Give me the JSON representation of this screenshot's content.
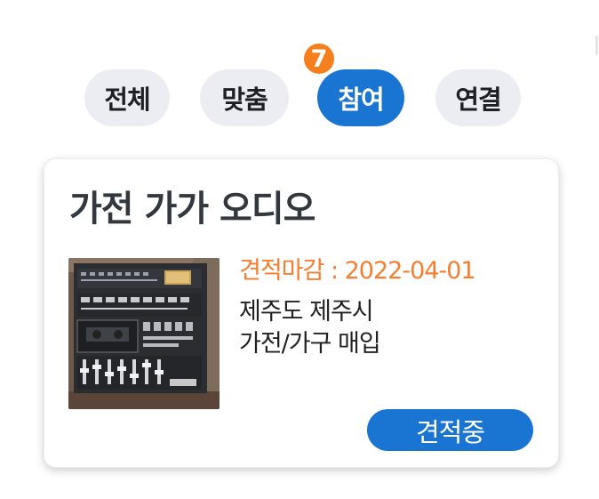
{
  "tabs": [
    {
      "label": "전체",
      "active": false
    },
    {
      "label": "맞춤",
      "active": false
    },
    {
      "label": "참여",
      "active": true
    },
    {
      "label": "연결",
      "active": false
    }
  ],
  "step_badge": "7",
  "colors": {
    "accent": "#1a74d1",
    "badge": "#f57f1c",
    "deadline_text": "#f57f30",
    "tab_bg": "#ecedf3"
  },
  "card": {
    "title": "가전 가가 오디오",
    "deadline": "견적마감 : 2022-04-01",
    "location": "제주도 제주시",
    "category": "가전/가구 매입",
    "status": "견적중",
    "thumbnail_icon": "stereo-photo"
  }
}
